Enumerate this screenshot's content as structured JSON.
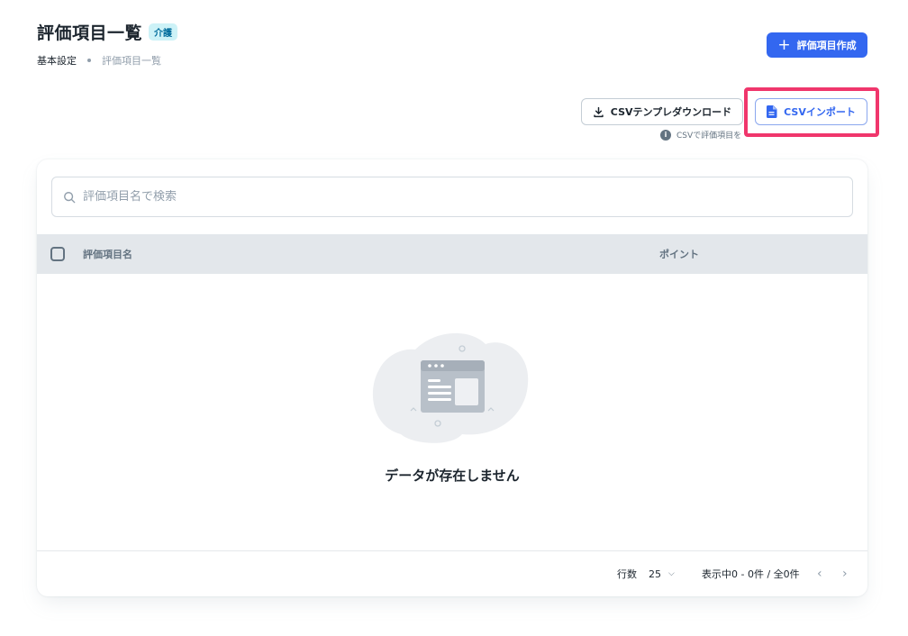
{
  "header": {
    "title": "評価項目一覧",
    "badge": "介護",
    "breadcrumb": [
      "基本設定",
      "評価項目一覧"
    ],
    "create_button": "評価項目作成"
  },
  "csv": {
    "download_button": "CSVテンプレダウンロード",
    "import_button": "CSVインポート",
    "hint": "CSVで評価項目を"
  },
  "search": {
    "placeholder": "評価項目名で検索",
    "value": ""
  },
  "table": {
    "columns": [
      "評価項目名",
      "ポイント"
    ],
    "rows": [],
    "empty_message": "データが存在しません"
  },
  "pagination": {
    "rows_label": "行数",
    "rows_per_page": "25",
    "range": "表示中0 - 0件 / 全0件"
  },
  "colors": {
    "primary": "#3367f0",
    "highlight": "#f0366c",
    "badge_bg": "#cdf2f7",
    "badge_text": "#006c9c"
  }
}
